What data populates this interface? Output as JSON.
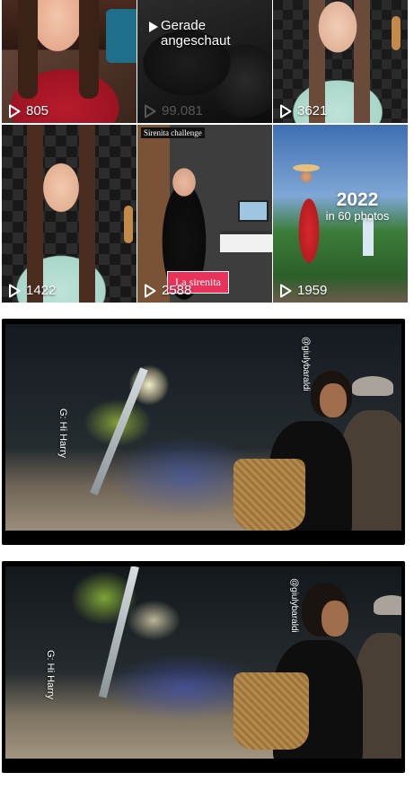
{
  "grid": {
    "tiles": [
      {
        "views": "805"
      },
      {
        "views": "99.081",
        "overlay": "Gerade angeschaut"
      },
      {
        "views": "3621"
      },
      {
        "views": "1422"
      },
      {
        "views": "2588",
        "header": "Sirenita challenge",
        "caption": "La sirenita"
      },
      {
        "views": "1959",
        "headline": "2022",
        "subline": "in 60 photos"
      }
    ]
  },
  "cards": [
    {
      "caption": "G: Hi Harry",
      "handle": "@giulybaraldi"
    },
    {
      "caption": "G: Hi Harry",
      "handle": "@giulybaraldi"
    }
  ],
  "icons": {
    "play": "play-icon"
  },
  "colors": {
    "caption_pink": "#e8325a",
    "views_text": "#ffffff"
  }
}
